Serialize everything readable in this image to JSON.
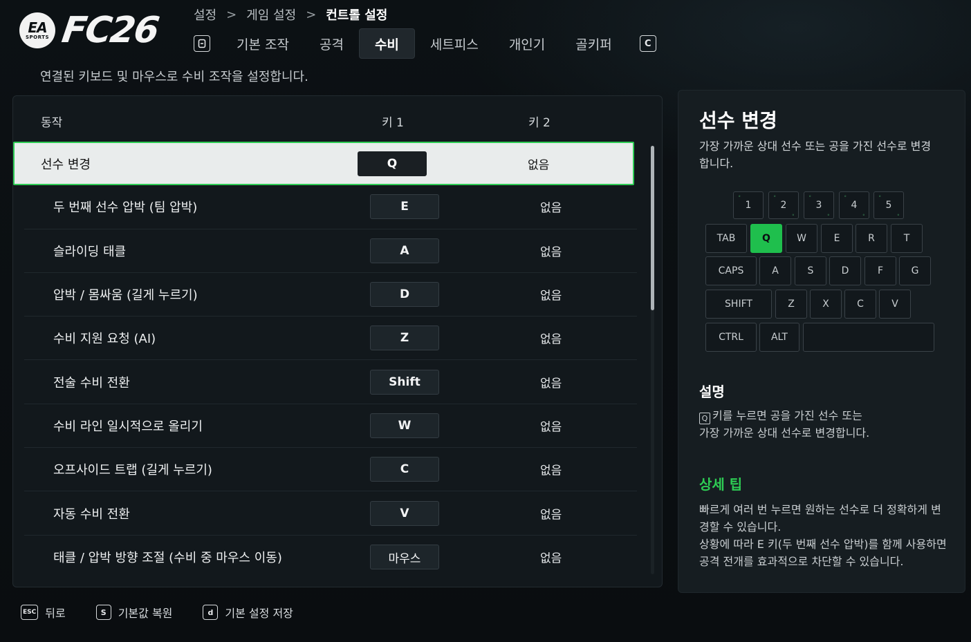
{
  "logo": {
    "ea_text": "EA",
    "sports_text": "SPORTS",
    "game_title": "FC26"
  },
  "breadcrumb": [
    "설정",
    "게임 설정",
    "컨트롤 설정"
  ],
  "breadcrumb_sep": ">",
  "tabs": {
    "prev_key": "⊟",
    "next_key": "C",
    "items": [
      "기본 조작",
      "공격",
      "수비",
      "세트피스",
      "개인기",
      "골키퍼"
    ],
    "active": "수비"
  },
  "subtitle": "연결된 키보드 및 마우스로 수비 조작을 설정합니다.",
  "table": {
    "headers": {
      "action": "동작",
      "key1": "키 1",
      "key2": "키 2"
    },
    "rows": [
      {
        "action": "선수 변경",
        "key1": "Q",
        "key2": "없음"
      },
      {
        "action": "두 번째 선수 압박 (팀 압박)",
        "key1": "E",
        "key2": "없음"
      },
      {
        "action": "슬라이딩 태클",
        "key1": "A",
        "key2": "없음"
      },
      {
        "action": "압박 /  몸싸움 (길게 누르기)",
        "key1": "D",
        "key2": "없음"
      },
      {
        "action": "수비 지원 요청 (AI)",
        "key1": "Z",
        "key2": "없음"
      },
      {
        "action": "전술 수비 전환",
        "key1": "Shift",
        "key2": "없음"
      },
      {
        "action": "수비 라인 일시적으로 올리기",
        "key1": "W",
        "key2": "없음"
      },
      {
        "action": "오프사이드 트랩 (길게 누르기)",
        "key1": "C",
        "key2": "없음"
      },
      {
        "action": "자동 수비 전환",
        "key1": "V",
        "key2": "없음"
      },
      {
        "action": "태클 / 압박 방향 조절 (수비 중 마우스 이동)",
        "key1": "마우스",
        "key2": "없음"
      }
    ],
    "selected_index": 0
  },
  "side": {
    "title": "선수 변경",
    "desc": "가장 가까운 상대 선수 또는 공을 가진 선수로 변경합니다.",
    "keyboard": {
      "num_row": [
        "1",
        "2",
        "3",
        "4",
        "5"
      ],
      "row1": [
        "TAB",
        "Q",
        "W",
        "E",
        "R",
        "T"
      ],
      "row2": [
        "CAPS",
        "A",
        "S",
        "D",
        "F",
        "G"
      ],
      "row3": [
        "SHIFT",
        "Z",
        "X",
        "C",
        "V"
      ],
      "row4": [
        "CTRL",
        "ALT",
        ""
      ],
      "highlight": "Q"
    },
    "explain_title": "설명",
    "explain_key": "Q",
    "explain_text_1": "키를 누르면 공을 가진 선수 또는",
    "explain_text_2": "가장 가까운 상대 선수로 변경합니다.",
    "tip_title": "상세 팁",
    "tip_text_1": "빠르게 여러 번 누르면 원하는 선수로 더 정확하게 변경할 수 있습니다.",
    "tip_text_2": "상황에 따라 E 키(두 번째 선수 압박)를 함께 사용하면 공격 전개를 효과적으로 차단할 수 있습니다.",
    "accent_color": "#2ecc54"
  },
  "footer": [
    {
      "key": "ESC",
      "label": "뒤로"
    },
    {
      "key": "S",
      "label": "기본값 복원"
    },
    {
      "key": "d",
      "label": "기본 설정 저장"
    }
  ]
}
